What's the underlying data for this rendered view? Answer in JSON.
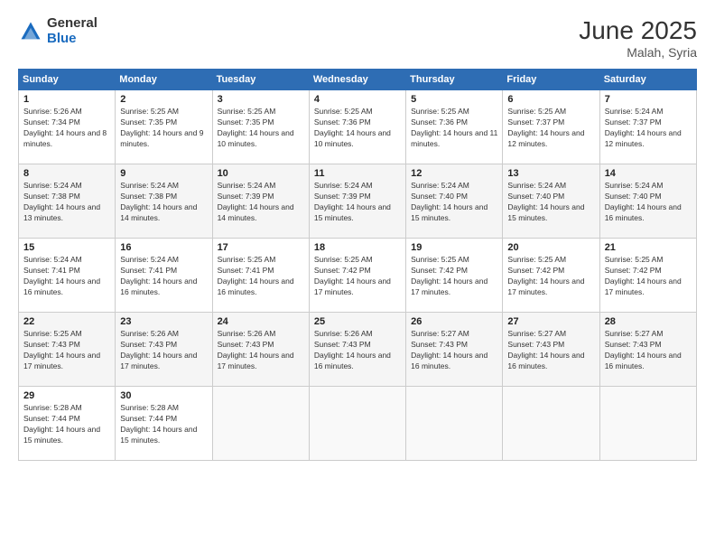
{
  "header": {
    "logo_general": "General",
    "logo_blue": "Blue",
    "month_title": "June 2025",
    "location": "Malah, Syria"
  },
  "days_of_week": [
    "Sunday",
    "Monday",
    "Tuesday",
    "Wednesday",
    "Thursday",
    "Friday",
    "Saturday"
  ],
  "weeks": [
    [
      {
        "day": 1,
        "sunrise": "5:26 AM",
        "sunset": "7:34 PM",
        "daylight": "14 hours and 8 minutes."
      },
      {
        "day": 2,
        "sunrise": "5:25 AM",
        "sunset": "7:35 PM",
        "daylight": "14 hours and 9 minutes."
      },
      {
        "day": 3,
        "sunrise": "5:25 AM",
        "sunset": "7:35 PM",
        "daylight": "14 hours and 10 minutes."
      },
      {
        "day": 4,
        "sunrise": "5:25 AM",
        "sunset": "7:36 PM",
        "daylight": "14 hours and 10 minutes."
      },
      {
        "day": 5,
        "sunrise": "5:25 AM",
        "sunset": "7:36 PM",
        "daylight": "14 hours and 11 minutes."
      },
      {
        "day": 6,
        "sunrise": "5:25 AM",
        "sunset": "7:37 PM",
        "daylight": "14 hours and 12 minutes."
      },
      {
        "day": 7,
        "sunrise": "5:24 AM",
        "sunset": "7:37 PM",
        "daylight": "14 hours and 12 minutes."
      }
    ],
    [
      {
        "day": 8,
        "sunrise": "5:24 AM",
        "sunset": "7:38 PM",
        "daylight": "14 hours and 13 minutes."
      },
      {
        "day": 9,
        "sunrise": "5:24 AM",
        "sunset": "7:38 PM",
        "daylight": "14 hours and 14 minutes."
      },
      {
        "day": 10,
        "sunrise": "5:24 AM",
        "sunset": "7:39 PM",
        "daylight": "14 hours and 14 minutes."
      },
      {
        "day": 11,
        "sunrise": "5:24 AM",
        "sunset": "7:39 PM",
        "daylight": "14 hours and 15 minutes."
      },
      {
        "day": 12,
        "sunrise": "5:24 AM",
        "sunset": "7:40 PM",
        "daylight": "14 hours and 15 minutes."
      },
      {
        "day": 13,
        "sunrise": "5:24 AM",
        "sunset": "7:40 PM",
        "daylight": "14 hours and 15 minutes."
      },
      {
        "day": 14,
        "sunrise": "5:24 AM",
        "sunset": "7:40 PM",
        "daylight": "14 hours and 16 minutes."
      }
    ],
    [
      {
        "day": 15,
        "sunrise": "5:24 AM",
        "sunset": "7:41 PM",
        "daylight": "14 hours and 16 minutes."
      },
      {
        "day": 16,
        "sunrise": "5:24 AM",
        "sunset": "7:41 PM",
        "daylight": "14 hours and 16 minutes."
      },
      {
        "day": 17,
        "sunrise": "5:25 AM",
        "sunset": "7:41 PM",
        "daylight": "14 hours and 16 minutes."
      },
      {
        "day": 18,
        "sunrise": "5:25 AM",
        "sunset": "7:42 PM",
        "daylight": "14 hours and 17 minutes."
      },
      {
        "day": 19,
        "sunrise": "5:25 AM",
        "sunset": "7:42 PM",
        "daylight": "14 hours and 17 minutes."
      },
      {
        "day": 20,
        "sunrise": "5:25 AM",
        "sunset": "7:42 PM",
        "daylight": "14 hours and 17 minutes."
      },
      {
        "day": 21,
        "sunrise": "5:25 AM",
        "sunset": "7:42 PM",
        "daylight": "14 hours and 17 minutes."
      }
    ],
    [
      {
        "day": 22,
        "sunrise": "5:25 AM",
        "sunset": "7:43 PM",
        "daylight": "14 hours and 17 minutes."
      },
      {
        "day": 23,
        "sunrise": "5:26 AM",
        "sunset": "7:43 PM",
        "daylight": "14 hours and 17 minutes."
      },
      {
        "day": 24,
        "sunrise": "5:26 AM",
        "sunset": "7:43 PM",
        "daylight": "14 hours and 17 minutes."
      },
      {
        "day": 25,
        "sunrise": "5:26 AM",
        "sunset": "7:43 PM",
        "daylight": "14 hours and 16 minutes."
      },
      {
        "day": 26,
        "sunrise": "5:27 AM",
        "sunset": "7:43 PM",
        "daylight": "14 hours and 16 minutes."
      },
      {
        "day": 27,
        "sunrise": "5:27 AM",
        "sunset": "7:43 PM",
        "daylight": "14 hours and 16 minutes."
      },
      {
        "day": 28,
        "sunrise": "5:27 AM",
        "sunset": "7:43 PM",
        "daylight": "14 hours and 16 minutes."
      }
    ],
    [
      {
        "day": 29,
        "sunrise": "5:28 AM",
        "sunset": "7:44 PM",
        "daylight": "14 hours and 15 minutes."
      },
      {
        "day": 30,
        "sunrise": "5:28 AM",
        "sunset": "7:44 PM",
        "daylight": "14 hours and 15 minutes."
      },
      null,
      null,
      null,
      null,
      null
    ]
  ]
}
